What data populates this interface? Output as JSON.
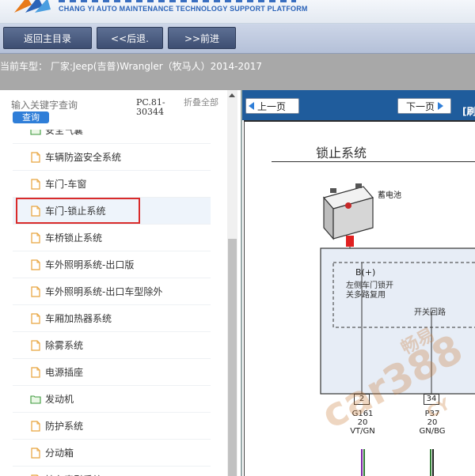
{
  "header": {
    "subtitle": "CHANG YI AUTO MAINTENANCE TECHNOLOGY SUPPORT PLATFORM"
  },
  "nav": {
    "home_label": "返回主目录",
    "back_label": "<<后退.",
    "forward_label": ">>前进"
  },
  "vehicle": {
    "info_text": "当前车型： 厂家:Jeep(吉普)Wrangler（牧马人）2014-2017"
  },
  "search": {
    "placeholder": "输入关键字查询",
    "button_label": "查询",
    "pc_code": "PC.81-30344",
    "collapse_label": "折叠全部"
  },
  "tree": {
    "items": [
      {
        "label": "安全气囊",
        "type": "folder-open"
      },
      {
        "label": "车辆防盗安全系统",
        "type": "file"
      },
      {
        "label": "车门-车窗",
        "type": "file"
      },
      {
        "label": "车门-锁止系统",
        "type": "file",
        "selected": true
      },
      {
        "label": "车桥锁止系统",
        "type": "file"
      },
      {
        "label": "车外照明系统-出口版",
        "type": "file"
      },
      {
        "label": "车外照明系统-出口车型除外",
        "type": "file"
      },
      {
        "label": "车厢加热器系统",
        "type": "file"
      },
      {
        "label": "除雾系统",
        "type": "file"
      },
      {
        "label": "电源插座",
        "type": "file"
      },
      {
        "label": "发动机",
        "type": "folder-open"
      },
      {
        "label": "防护系统",
        "type": "file"
      },
      {
        "label": "分动箱",
        "type": "file"
      },
      {
        "label": "挂车牵引系统",
        "type": "file"
      }
    ]
  },
  "viewer": {
    "prev_label": "上一页",
    "next_label": "下一页",
    "refresh_label": "[刷",
    "title": "锁止系统",
    "battery_label": "蓄电池",
    "bplus_label": "B(+)",
    "switch_note": "左侧车门锁开关多路复用",
    "circuit_label": "开关回路",
    "pins": [
      "2",
      "34"
    ],
    "wires": [
      {
        "code": "G161",
        "gauge": "20",
        "color": "VT/GN"
      },
      {
        "code": "P37",
        "gauge": "20",
        "color": "GN/BG"
      }
    ],
    "watermark_main": "car388",
    "watermark_sub": "畅易",
    "watermark_tail": "CY"
  },
  "colors": {
    "nav_button": "#3d4e72",
    "viewer_toolbar": "#1f5c9c",
    "selected_outline": "#d92b2b",
    "accent_blue": "#2f7ed8"
  }
}
